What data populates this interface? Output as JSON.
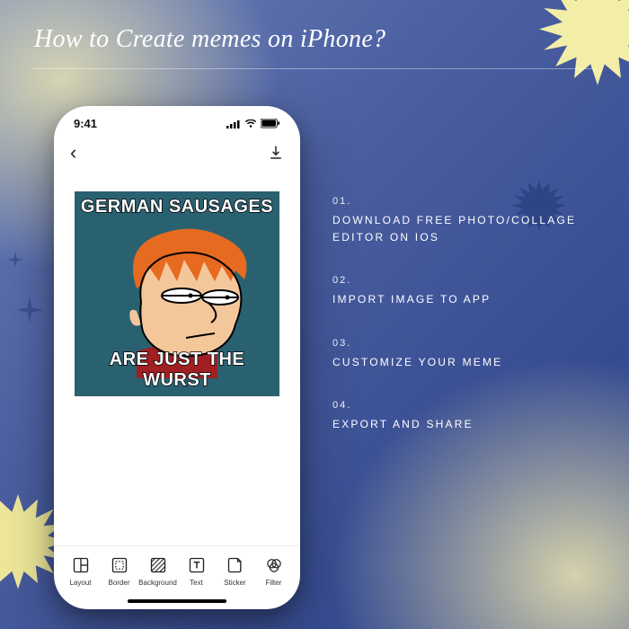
{
  "page": {
    "title": "How to Create memes on iPhone?"
  },
  "steps": [
    {
      "num": "01.",
      "label": "DOWNLOAD FREE PHOTO/COLLAGE EDITOR ON IOS"
    },
    {
      "num": "02.",
      "label": "IMPORT IMAGE TO APP"
    },
    {
      "num": "03.",
      "label": "CUSTOMIZE YOUR MEME"
    },
    {
      "num": "04.",
      "label": "EXPORT AND SHARE"
    }
  ],
  "phone": {
    "time": "9:41",
    "meme": {
      "top": "GERMAN SAUSAGES",
      "bottom": "ARE JUST THE WURST"
    },
    "tools": {
      "layout": "Layout",
      "border": "Border",
      "background": "Background",
      "text": "Text",
      "sticker": "Sticker",
      "filter": "Filter"
    }
  }
}
